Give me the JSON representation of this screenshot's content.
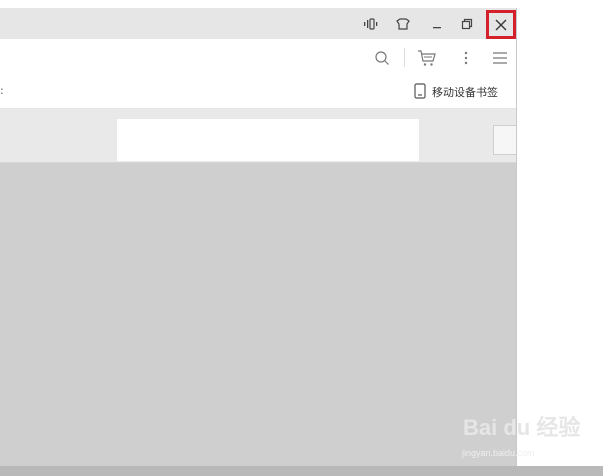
{
  "titlebar": {
    "icons": [
      "signal-icon",
      "skin-icon",
      "minimize-icon",
      "restore-icon",
      "close-icon"
    ]
  },
  "toolbar": {
    "icons": [
      "search-icon",
      "cart-icon",
      "more-icon",
      "menu-icon"
    ]
  },
  "bookmarks": {
    "left_fragment": ":",
    "mobile_bookmark_label": "移动设备书签"
  },
  "watermark": {
    "brand": "Bai du 经验",
    "site": "jingyan.baidu.com"
  },
  "colors": {
    "close_highlight": "#d4202a",
    "titlebar_bg": "#e6e6e6",
    "content_bg": "#cfcfcf"
  }
}
